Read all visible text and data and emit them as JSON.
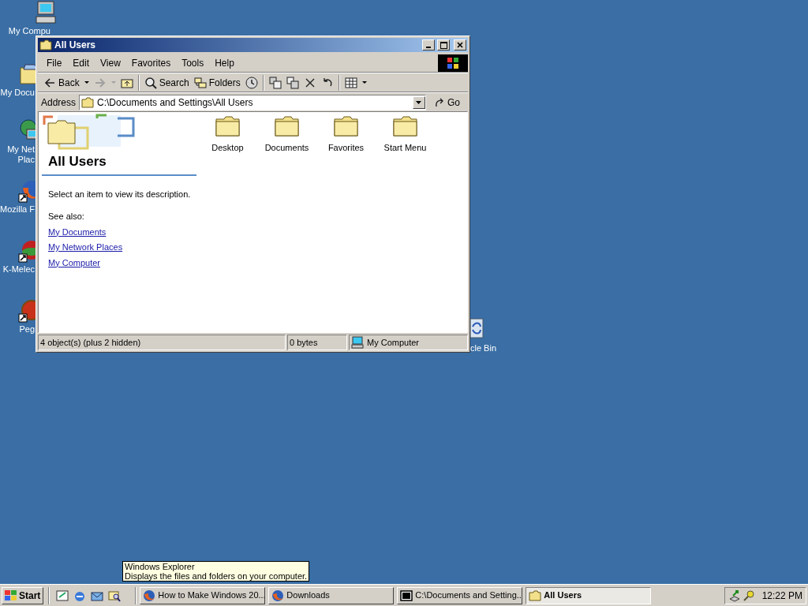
{
  "desktop_icons": [
    {
      "kind": "computer",
      "lines": [
        "My Compu"
      ]
    },
    {
      "kind": "documents",
      "lines": [
        "My Docu"
      ]
    },
    {
      "kind": "network",
      "lines": [
        "My Net",
        "Plac"
      ]
    },
    {
      "kind": "firefox",
      "lines": [
        "Mozilla F"
      ]
    },
    {
      "kind": "kmeleon",
      "lines": [
        "K-Melec"
      ]
    },
    {
      "kind": "pegasus",
      "lines": [
        "Peg"
      ]
    }
  ],
  "recycle_bin": {
    "label": "cle Bin"
  },
  "window": {
    "title": "All Users",
    "menu": [
      "File",
      "Edit",
      "View",
      "Favorites",
      "Tools",
      "Help"
    ],
    "toolbar": {
      "groups": [
        [
          {
            "kind": "back",
            "label": "Back",
            "dropdown": true,
            "disabled": false
          },
          {
            "kind": "forward",
            "dropdown": true,
            "disabled": true
          },
          {
            "kind": "up",
            "disabled": false
          }
        ],
        [
          {
            "kind": "search",
            "label": "Search",
            "disabled": false
          },
          {
            "kind": "folders",
            "label": "Folders",
            "disabled": false
          },
          {
            "kind": "history",
            "disabled": false
          }
        ],
        [
          {
            "kind": "move",
            "disabled": false
          },
          {
            "kind": "copy",
            "disabled": false
          },
          {
            "kind": "delete",
            "disabled": false
          },
          {
            "kind": "undo",
            "disabled": false
          }
        ],
        [
          {
            "kind": "views",
            "dropdown": true,
            "disabled": false
          }
        ]
      ]
    },
    "address": {
      "label": "Address",
      "value": "C:\\Documents and Settings\\All Users",
      "go": "Go"
    },
    "panel": {
      "title": "All Users",
      "description": "Select an item to view its description.",
      "see_also": "See also:",
      "links": [
        "My Documents",
        "My Network Places",
        "My Computer"
      ]
    },
    "items": [
      {
        "label": "Desktop"
      },
      {
        "label": "Documents"
      },
      {
        "label": "Favorites"
      },
      {
        "label": "Start Menu"
      }
    ],
    "status_bar": {
      "objects": "4 object(s) (plus 2 hidden)",
      "size": "0 bytes",
      "zone": "My Computer"
    }
  },
  "tooltip": {
    "title": "Windows Explorer",
    "text": "Displays the files and folders on your computer."
  },
  "taskbar": {
    "start": "Start",
    "quick_launch": [
      {
        "kind": "desktop"
      },
      {
        "kind": "ie"
      },
      {
        "kind": "outlook"
      },
      {
        "kind": "explorer"
      }
    ],
    "tasks": [
      {
        "kind": "firefox",
        "label": "How to Make Windows 20...",
        "selected": false
      },
      {
        "kind": "firefox",
        "label": "Downloads",
        "selected": false
      },
      {
        "kind": "sevenzip",
        "label": "C:\\Documents and Setting...",
        "selected": false
      },
      {
        "kind": "folder",
        "label": "All Users",
        "selected": true
      }
    ],
    "clock": "12:22 PM"
  }
}
